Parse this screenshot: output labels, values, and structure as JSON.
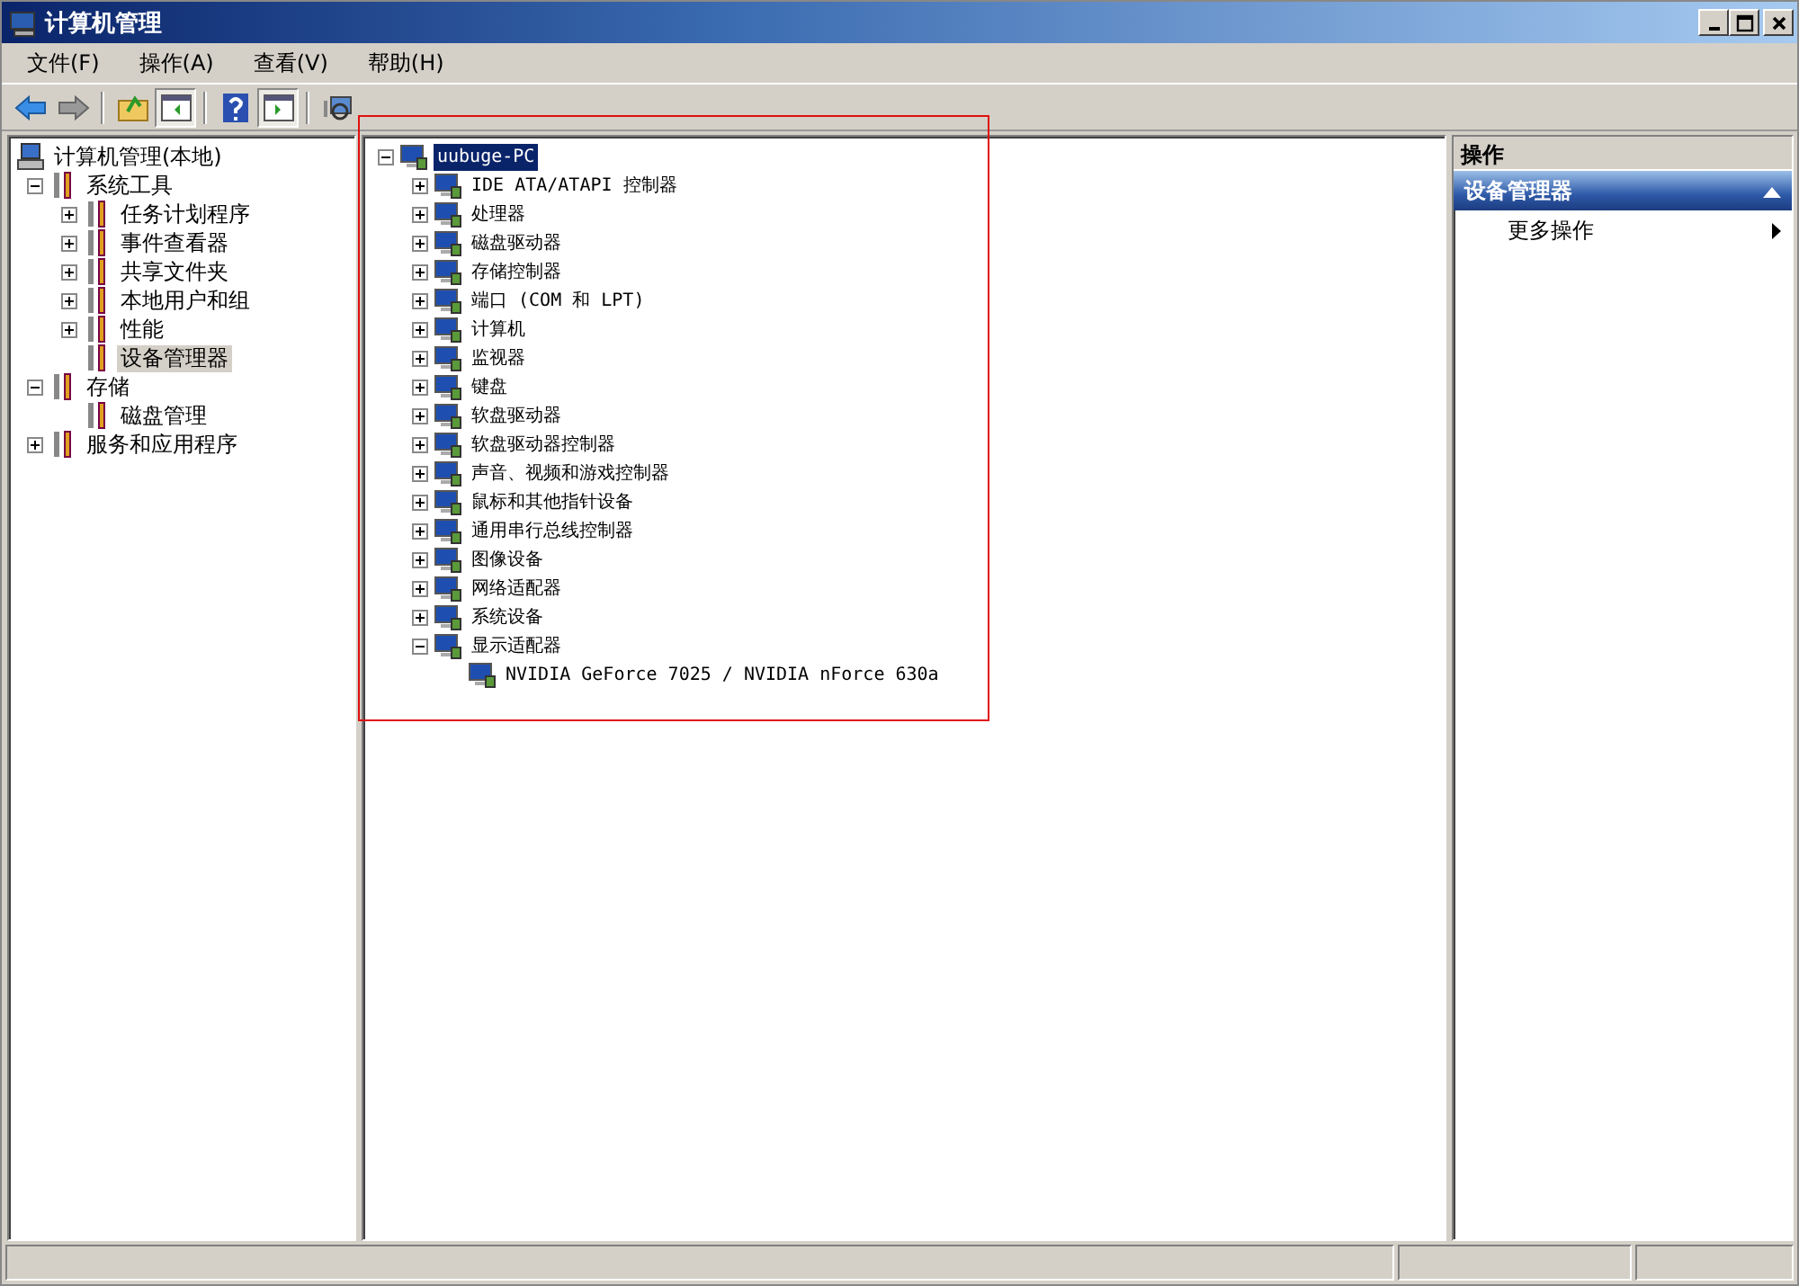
{
  "window": {
    "title": "计算机管理"
  },
  "menu": [
    "文件(F)",
    "操作(A)",
    "查看(V)",
    "帮助(H)"
  ],
  "left_tree": [
    {
      "label": "计算机管理(本地)",
      "kind": "root",
      "selected": false,
      "children": [
        {
          "label": "系统工具",
          "kind": "branch",
          "expanded": true,
          "selected": false,
          "children": [
            {
              "label": "任务计划程序",
              "kind": "branch",
              "expanded": false,
              "selected": false
            },
            {
              "label": "事件查看器",
              "kind": "branch",
              "expanded": false,
              "selected": false
            },
            {
              "label": "共享文件夹",
              "kind": "branch",
              "expanded": false,
              "selected": false
            },
            {
              "label": "本地用户和组",
              "kind": "branch",
              "expanded": false,
              "selected": false
            },
            {
              "label": "性能",
              "kind": "branch",
              "expanded": false,
              "selected": false
            },
            {
              "label": "设备管理器",
              "kind": "leaf",
              "selected": true
            }
          ]
        },
        {
          "label": "存储",
          "kind": "branch",
          "expanded": true,
          "selected": false,
          "children": [
            {
              "label": "磁盘管理",
              "kind": "leaf",
              "selected": false
            }
          ]
        },
        {
          "label": "服务和应用程序",
          "kind": "branch",
          "expanded": false,
          "selected": false
        }
      ]
    }
  ],
  "device_tree": [
    {
      "label": "uubuge-PC",
      "kind": "branch",
      "expanded": true,
      "selected": true,
      "children": [
        {
          "label": "IDE ATA/ATAPI 控制器",
          "kind": "branch",
          "expanded": false,
          "selected": false
        },
        {
          "label": "处理器",
          "kind": "branch",
          "expanded": false,
          "selected": false
        },
        {
          "label": "磁盘驱动器",
          "kind": "branch",
          "expanded": false,
          "selected": false
        },
        {
          "label": "存储控制器",
          "kind": "branch",
          "expanded": false,
          "selected": false
        },
        {
          "label": "端口 (COM 和 LPT)",
          "kind": "branch",
          "expanded": false,
          "selected": false
        },
        {
          "label": "计算机",
          "kind": "branch",
          "expanded": false,
          "selected": false
        },
        {
          "label": "监视器",
          "kind": "branch",
          "expanded": false,
          "selected": false
        },
        {
          "label": "键盘",
          "kind": "branch",
          "expanded": false,
          "selected": false
        },
        {
          "label": "软盘驱动器",
          "kind": "branch",
          "expanded": false,
          "selected": false
        },
        {
          "label": "软盘驱动器控制器",
          "kind": "branch",
          "expanded": false,
          "selected": false
        },
        {
          "label": "声音、视频和游戏控制器",
          "kind": "branch",
          "expanded": false,
          "selected": false
        },
        {
          "label": "鼠标和其他指针设备",
          "kind": "branch",
          "expanded": false,
          "selected": false
        },
        {
          "label": "通用串行总线控制器",
          "kind": "branch",
          "expanded": false,
          "selected": false
        },
        {
          "label": "图像设备",
          "kind": "branch",
          "expanded": false,
          "selected": false
        },
        {
          "label": "网络适配器",
          "kind": "branch",
          "expanded": false,
          "selected": false
        },
        {
          "label": "系统设备",
          "kind": "branch",
          "expanded": false,
          "selected": false
        },
        {
          "label": "显示适配器",
          "kind": "branch",
          "expanded": true,
          "selected": false,
          "children": [
            {
              "label": "NVIDIA GeForce 7025 / NVIDIA nForce 630a",
              "kind": "leaf",
              "selected": false
            }
          ]
        }
      ]
    }
  ],
  "actions": {
    "title": "操作",
    "section": {
      "title": "设备管理器",
      "expanded": true
    },
    "items": [
      {
        "label": "更多操作"
      }
    ]
  }
}
